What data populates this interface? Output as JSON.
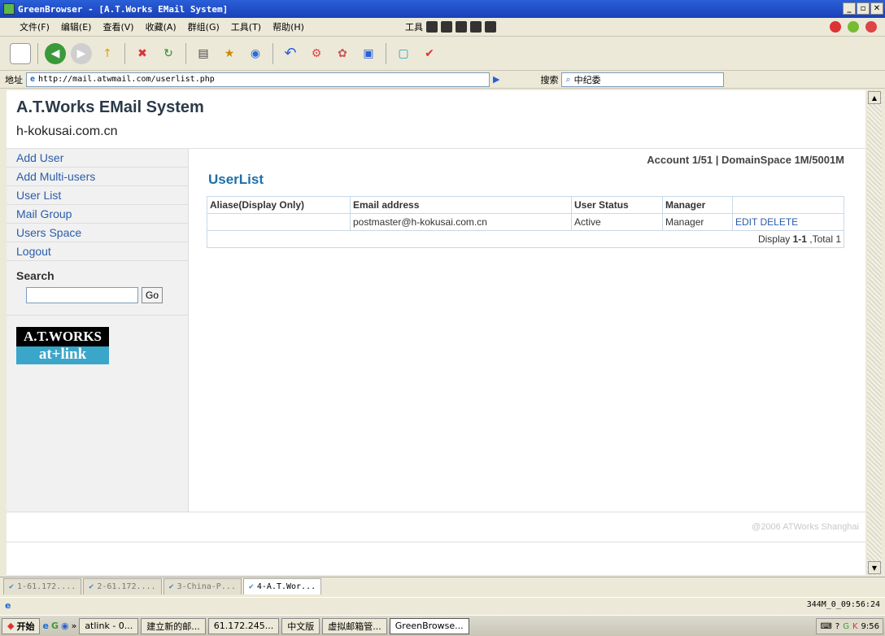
{
  "window": {
    "title": "GreenBrowser - [A.T.Works EMail System]"
  },
  "menubar": {
    "items": [
      "文件(F)",
      "编辑(E)",
      "查看(V)",
      "收藏(A)",
      "群组(G)",
      "工具(T)",
      "帮助(H)"
    ],
    "tools_label": "工具"
  },
  "addressbar": {
    "label": "地址",
    "url": "http://mail.atwmail.com/userlist.php",
    "search_label": "搜索",
    "search_value": "中纪委"
  },
  "site": {
    "title": "A.T.Works EMail System",
    "domain": "h-kokusai.com.cn"
  },
  "sidebar": {
    "items": [
      {
        "label": "Add User"
      },
      {
        "label": "Add Multi-users"
      },
      {
        "label": "User List"
      },
      {
        "label": "Mail Group"
      },
      {
        "label": "Users Space"
      },
      {
        "label": "Logout"
      }
    ],
    "search_label": "Search",
    "search_value": "",
    "go_label": "Go",
    "logo_top": "A.T.WORKS",
    "logo_bottom": "at+link"
  },
  "main": {
    "account_info": "Account 1/51 | DomainSpace 1M/5001M",
    "page_title": "UserList",
    "table": {
      "headers": [
        "Aliase(Display Only)",
        "Email address",
        "User Status",
        "Manager",
        ""
      ],
      "rows": [
        {
          "alias": "",
          "email": "postmaster@h-kokusai.com.cn",
          "status": "Active",
          "manager": "Manager",
          "edit": "EDIT",
          "delete": "DELETE"
        }
      ],
      "footer_prefix": "Display ",
      "footer_range": "1-1",
      "footer_suffix": " ,Total 1"
    }
  },
  "footer": {
    "copyright": "@2006 ATWorks Shanghai"
  },
  "tabs": [
    {
      "label": "1-61.172....",
      "active": false
    },
    {
      "label": "2-61.172....",
      "active": false
    },
    {
      "label": "3-China-P...",
      "active": false
    },
    {
      "label": "4-A.T.Wor...",
      "active": true
    }
  ],
  "statusbar": {
    "right_text": "344M_0_09:56:24"
  },
  "taskbar": {
    "start_label": "开始",
    "buttons": [
      "atlink - 0...",
      "建立新的邮...",
      "61.172.245...",
      "中文版",
      "虚拟邮箱管...",
      "GreenBrowse..."
    ],
    "clock": "9:56"
  },
  "colors": {
    "title_bar": "#1941b8",
    "link": "#2a5da8",
    "page_title": "#1e6fa8",
    "logo_black": "#000000",
    "logo_teal": "#3aa6c9"
  }
}
